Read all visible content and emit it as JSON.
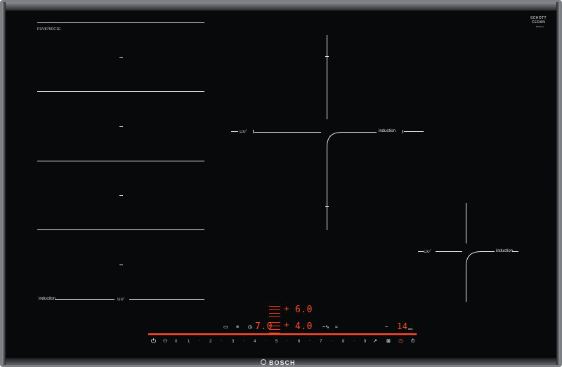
{
  "model_label": "PXV875DC1E",
  "brand": {
    "glass_line1": "SCHOTT",
    "glass_line2": "CERAN",
    "glass_sub": "BOSCH",
    "logo": "BOSCH",
    "logo_mark": "bosch-armature-icon"
  },
  "zones": {
    "flex_label": "induction",
    "center_label": "induction",
    "right_label": "induction",
    "bridge_icon_glyph": "⊔∪′"
  },
  "controls": {
    "power_glyph": "⏻",
    "scale": [
      "0",
      "1",
      "2",
      "3",
      "4",
      "5",
      "6",
      "7",
      "8",
      "9"
    ],
    "settings": {
      "upper_value": "6.0",
      "lower_value": "4.0",
      "left_value": "7.0",
      "timer_value": "14"
    }
  },
  "colors": {
    "glass": "#08090a",
    "frame": "#7c7f83",
    "display_red": "#ff4d2e",
    "markings": "#e8e8e8"
  }
}
